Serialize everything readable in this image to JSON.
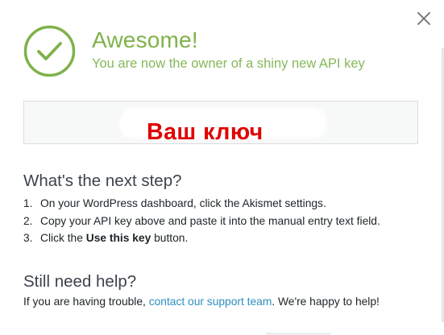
{
  "dialog": {
    "close_icon": "close-icon",
    "success_icon": "check-circle-icon",
    "title": "Awesome!",
    "subtitle": "You are now the owner of a shiny new API key",
    "accent_color": "#7fb24a"
  },
  "api_key": {
    "overlay_text": "Ваш ключ",
    "overlay_color": "#e00000"
  },
  "next_step": {
    "heading": "What's the next step?",
    "steps": [
      {
        "num": "1.",
        "text": "On your WordPress dashboard, click the Akismet settings."
      },
      {
        "num": "2.",
        "text": "Copy your API key above and paste it into the manual entry text field."
      },
      {
        "num": "3.",
        "before": "Click the ",
        "bold": "Use this key",
        "after": " button."
      }
    ]
  },
  "help": {
    "heading": "Still need help?",
    "text_before": "If you are having trouble, ",
    "link_text": "contact our support team",
    "text_after": ". We're happy to help!",
    "link_color": "#2b8fbf"
  }
}
